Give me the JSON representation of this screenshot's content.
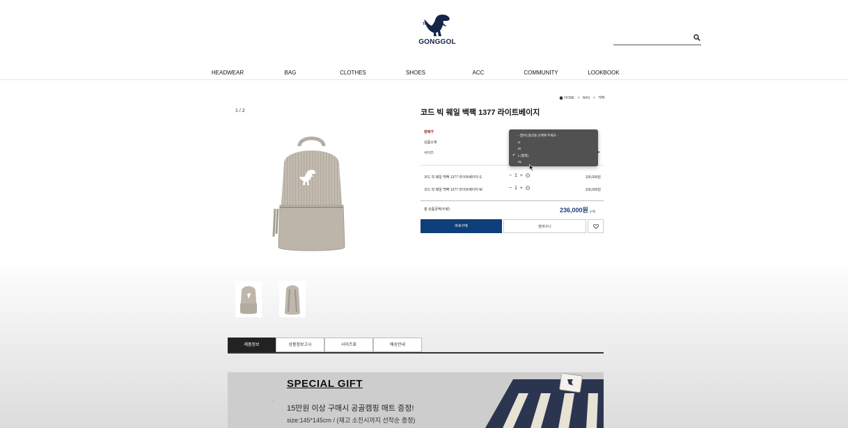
{
  "header": {
    "logo_tm": "TM",
    "logo_text": "GONGGOL",
    "search_placeholder": ""
  },
  "gnb": [
    "HEADWEAR",
    "BAG",
    "CLOTHES",
    "SHOES",
    "ACC",
    "COMMUNITY",
    "LOOKBOOK"
  ],
  "gallery": {
    "counter": "1 / 2"
  },
  "breadcrumb": [
    "HOME",
    ">",
    "BAG",
    ">",
    "백팩"
  ],
  "product": {
    "title": "코드 빅 웨일 백팩 1377 라이트베이지",
    "label_price": "판매가",
    "label_material": "상품소재",
    "label_size": "사이즈",
    "size_options": [
      "- [필수] 옵션을 선택해 주세요 -",
      "S",
      "M",
      "L (품절)",
      "XL"
    ],
    "size_selected": "L (품절)",
    "selected_items": [
      {
        "name": "코드 빅 웨일 백팩 1377 라이트베이지-S",
        "qty": "1",
        "price": "118,000원"
      },
      {
        "name": "코드 빅 웨일 백팩 1377 라이트베이지-M",
        "qty": "1",
        "price": "118,000원"
      }
    ],
    "total_label": "총 상품금액(수량)",
    "total_value": "236,000원",
    "total_count": "(2개)",
    "buy_label": "바로구매",
    "cart_label": "장바구니"
  },
  "tabs": [
    "제품정보",
    "상품정보고시",
    "사이즈표",
    "배송안내"
  ],
  "banner": {
    "title": "SPECIAL GIFT",
    "line1": "15만원 이상 구매시 공골캠핑 매트 증정!",
    "line2": "size:145*145cm / (재고 소진시까지 선착순 증정)"
  },
  "colors": {
    "brand_navy": "#14254a",
    "buy_button": "#0e3f7a",
    "total_price": "#1b3d7a",
    "price_label": "#8b1a1a"
  },
  "icons": [
    "dinosaur-logo-icon",
    "search-icon",
    "home-icon",
    "heart-icon",
    "checkmark-icon",
    "cursor-icon"
  ]
}
